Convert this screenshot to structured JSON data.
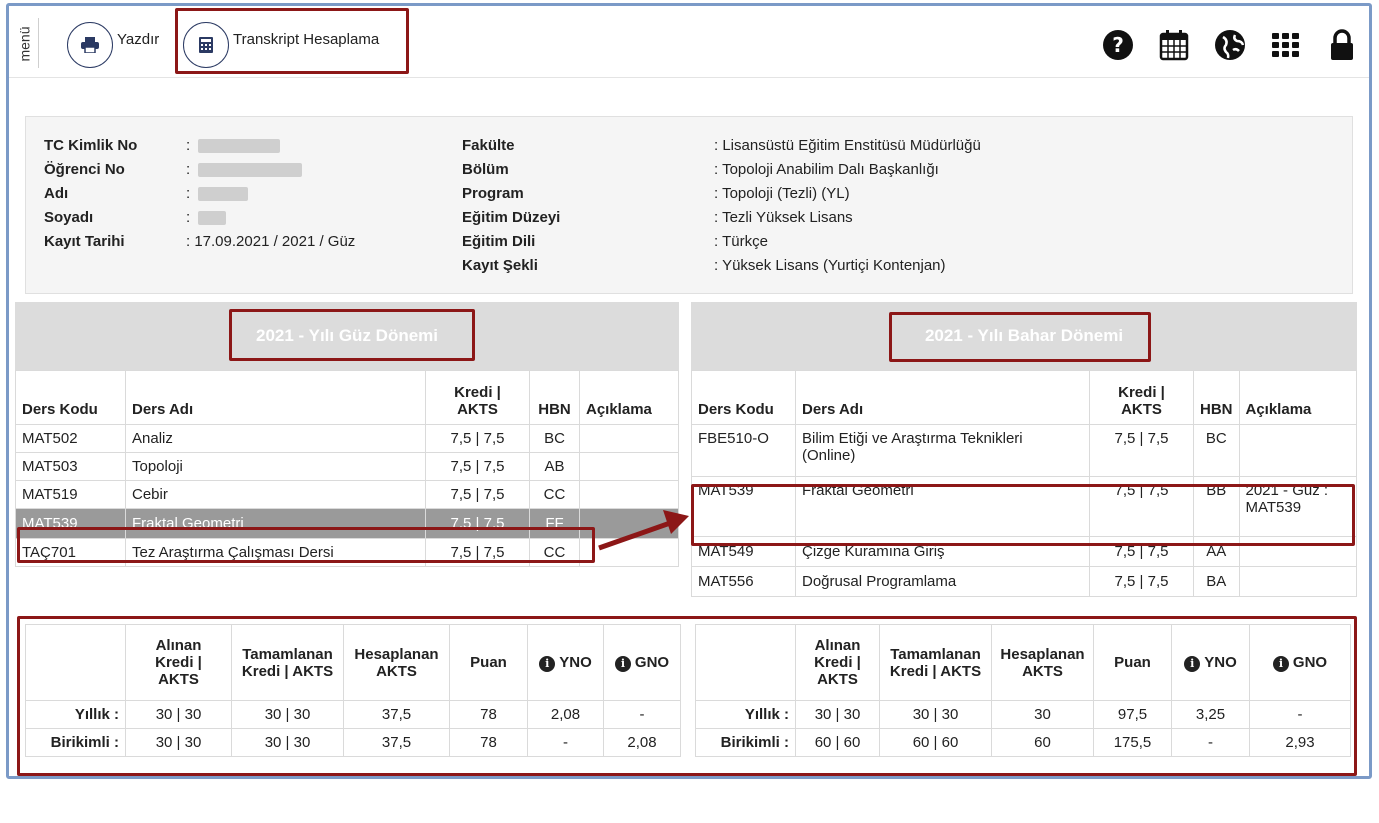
{
  "toolbar": {
    "menu_label": "menü",
    "print_label": "Yazdır",
    "transcript_label": "Transkript Hesaplama"
  },
  "header_icons": [
    "help-icon",
    "calendar-icon",
    "globe-icon",
    "grid-icon",
    "lock-icon"
  ],
  "student": {
    "labels": [
      "TC Kimlik No",
      "Öğrenci No",
      "Adı",
      "Soyadı",
      "Kayıt Tarihi"
    ],
    "separator": ":",
    "kayit_tarihi": ": 17.09.2021 / 2021 / Güz"
  },
  "program": {
    "labels": [
      "Fakülte",
      "Bölüm",
      "Program",
      "Eğitim Düzeyi",
      "Eğitim Dili",
      "Kayıt Şekli"
    ],
    "values": [
      ": Lisansüstü Eğitim Enstitüsü Müdürlüğü",
      ": Topoloji Anabilim Dalı Başkanlığı",
      ": Topoloji (Tezli) (YL)",
      ": Tezli Yüksek Lisans",
      ": Türkçe",
      ": Yüksek Lisans (Yurtiçi Kontenjan)"
    ]
  },
  "columns": {
    "code": "Ders Kodu",
    "name": "Ders Adı",
    "kredi1": "Kredi |",
    "kredi2": "AKTS",
    "hbn": "HBN",
    "note": "Açıklama"
  },
  "fall": {
    "title": "2021 - Yılı Güz Dönemi",
    "courses": [
      {
        "code": "MAT502",
        "name": "Analiz",
        "kredi": "7,5 | 7,5",
        "hbn": "BC",
        "note": ""
      },
      {
        "code": "MAT503",
        "name": "Topoloji",
        "kredi": "7,5 | 7,5",
        "hbn": "AB",
        "note": ""
      },
      {
        "code": "MAT519",
        "name": "Cebir",
        "kredi": "7,5 | 7,5",
        "hbn": "CC",
        "note": ""
      },
      {
        "code": "MAT539",
        "name": "Fraktal Geometri",
        "kredi": "7,5 | 7,5",
        "hbn": "FF",
        "note": ""
      },
      {
        "code": "TAÇ701",
        "name": "Tez Araştırma Çalışması Dersi",
        "kredi": "7,5 | 7,5",
        "hbn": "CC",
        "note": ""
      }
    ]
  },
  "spring": {
    "title": "2021 - Yılı Bahar Dönemi",
    "courses": [
      {
        "code": "FBE510-O",
        "name1": "Bilim Etiği ve Araştırma Teknikleri",
        "name2": "(Online)",
        "kredi": "7,5 | 7,5",
        "hbn": "BC",
        "note1": "",
        "note2": ""
      },
      {
        "code": "MAT539",
        "name1": "Fraktal Geometri",
        "name2": "",
        "kredi": "7,5 | 7,5",
        "hbn": "BB",
        "note1": "2021 - Guz :",
        "note2": "MAT539"
      },
      {
        "code": "MAT549",
        "name1": "Çizge Kuramına Giriş",
        "name2": "",
        "kredi": "7,5 | 7,5",
        "hbn": "AA",
        "note1": "",
        "note2": ""
      },
      {
        "code": "MAT556",
        "name1": "Doğrusal Programlama",
        "name2": "",
        "kredi": "7,5 | 7,5",
        "hbn": "BA",
        "note1": "",
        "note2": ""
      }
    ]
  },
  "summary_headers": {
    "alinan": [
      "Alınan",
      "Kredi |",
      "AKTS"
    ],
    "tamamlanan": [
      "Tamamlanan",
      "Kredi | AKTS"
    ],
    "hesaplanan": [
      "Hesaplanan",
      "AKTS"
    ],
    "puan": "Puan",
    "yno": "YNO",
    "gno": "GNO"
  },
  "summary_fall": {
    "yillik": {
      "label": "Yıllık :",
      "alinan": "30 | 30",
      "tamamlanan": "30 | 30",
      "hesaplanan": "37,5",
      "puan": "78",
      "yno": "2,08",
      "gno": "-"
    },
    "birikimli": {
      "label": "Birikimli :",
      "alinan": "30 | 30",
      "tamamlanan": "30 | 30",
      "hesaplanan": "37,5",
      "puan": "78",
      "yno": "-",
      "gno": "2,08"
    }
  },
  "summary_spring": {
    "yillik": {
      "label": "Yıllık :",
      "alinan": "30 | 30",
      "tamamlanan": "30 | 30",
      "hesaplanan": "30",
      "puan": "97,5",
      "yno": "3,25",
      "gno": "-"
    },
    "birikimli": {
      "label": "Birikimli :",
      "alinan": "60 | 60",
      "tamamlanan": "60 | 60",
      "hesaplanan": "60",
      "puan": "175,5",
      "yno": "-",
      "gno": "2,93"
    }
  },
  "colors": {
    "highlight": "#8c1717",
    "selected_row": "#9a9a9a",
    "header_bg": "#dcdcdc",
    "frame": "#7b9ac7"
  }
}
